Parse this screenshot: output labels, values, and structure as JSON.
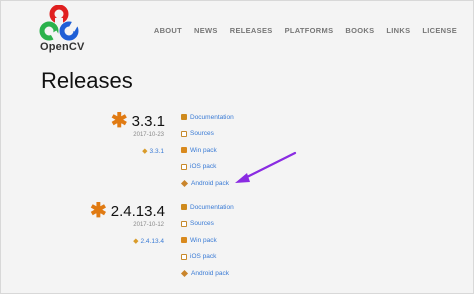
{
  "header": {
    "logo_text": "OpenCV",
    "nav": [
      "ABOUT",
      "NEWS",
      "RELEASES",
      "PLATFORMS",
      "BOOKS",
      "LINKS",
      "LICENSE"
    ]
  },
  "page_title": "Releases",
  "releases": [
    {
      "version": "3.3.1",
      "date": "2017-10-23",
      "tag": "3.3.1",
      "links": [
        "Documentation",
        "Sources",
        "Win pack",
        "iOS pack",
        "Android pack"
      ]
    },
    {
      "version": "2.4.13.4",
      "date": "2017-10-12",
      "tag": "2.4.13.4",
      "links": [
        "Documentation",
        "Sources",
        "Win pack",
        "iOS pack",
        "Android pack"
      ]
    }
  ],
  "colors": {
    "accent_star": "#e07a12",
    "link": "#3a7bd5",
    "annotation_arrow": "#8a2be2"
  },
  "icons": [
    "opencv-logo-icon",
    "star-icon",
    "tag-icon",
    "document-icon",
    "source-icon",
    "windows-icon",
    "ios-icon",
    "android-icon",
    "annotation-arrow"
  ]
}
